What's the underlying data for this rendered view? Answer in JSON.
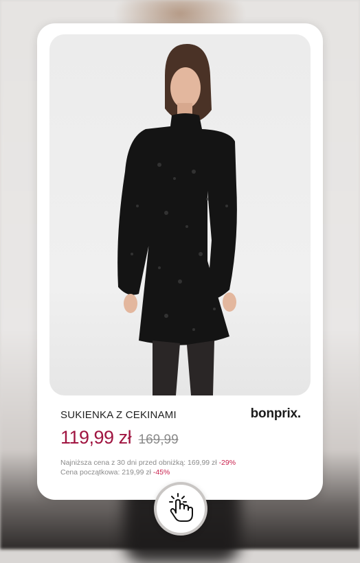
{
  "product": {
    "title": "SUKIENKA Z CEKINAMI",
    "brand": "bonprix.",
    "price_current": "119,99 zł",
    "price_old": "169,99",
    "lowest_price_label": "Najniższa cena z 30 dni  przed obniżką: 169,99 zł ",
    "lowest_price_discount": "-29%",
    "initial_price_label": "Cena początkowa: 219,99 zł ",
    "initial_price_discount": "-45%"
  },
  "icons": {
    "cta": "tap-hand-icon"
  },
  "colors": {
    "price": "#a01541",
    "discount": "#c81e4b",
    "dress": "#141414"
  }
}
